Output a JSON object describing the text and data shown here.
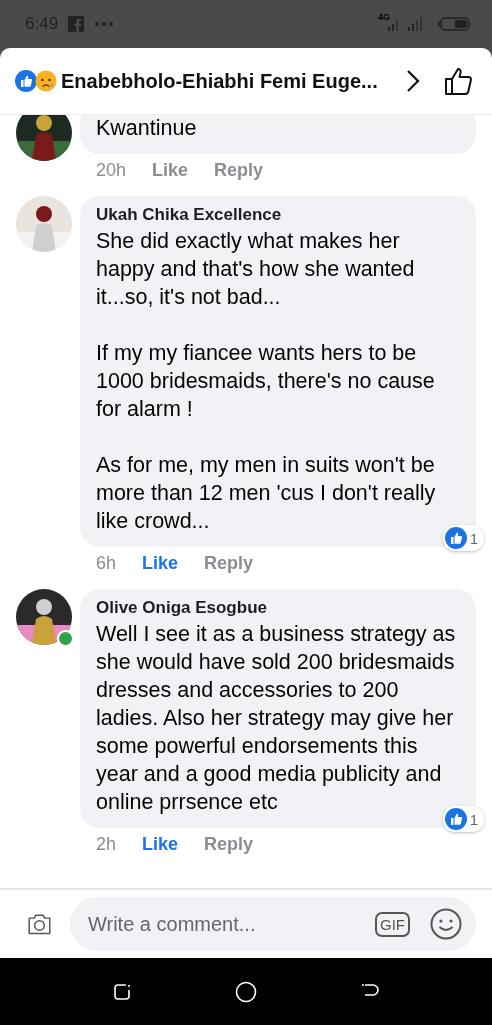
{
  "status_bar": {
    "time": "6:49",
    "network": "4G"
  },
  "header": {
    "title": "Enabebholo-Ehiabhi Femi Euge..."
  },
  "comments": [
    {
      "online": false,
      "paragraphs": [
        "Kwantinue"
      ],
      "time": "20h",
      "like": "Like",
      "liked": false,
      "reply": "Reply"
    },
    {
      "author": "Ukah Chika Excellence",
      "online": false,
      "paragraphs": [
        "She did exactly what makes her happy and that's how she wanted it...so, it's not bad...",
        "If my my fiancee wants hers to be 1000 bridesmaids, there's no cause for alarm !",
        "As for me, my men in suits won't be more than 12 men 'cus I don't really like crowd..."
      ],
      "time": "6h",
      "like": "Like",
      "liked": true,
      "reply": "Reply",
      "reactions": "1"
    },
    {
      "author": "Olive Oniga Esogbue",
      "online": true,
      "paragraphs": [
        "Well I see it as a business strategy as she would have sold 200 bridesmaids dresses and accessories to 200 ladies. Also her strategy may give her some powerful endorsements this year and a good media publicity and online prrsence etc"
      ],
      "time": "2h",
      "like": "Like",
      "liked": true,
      "reply": "Reply",
      "reactions": "1"
    }
  ],
  "composer": {
    "placeholder": "Write a comment...",
    "gif_label": "GIF"
  }
}
